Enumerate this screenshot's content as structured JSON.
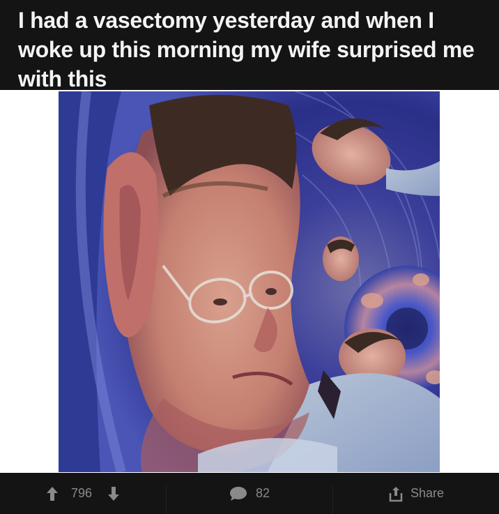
{
  "post": {
    "title": "I had a vasectomy yesterday and when I woke up this morning my wife surprised me with this"
  },
  "image": {
    "alt": "Swirled, distorted portrait of a balding man with glasses, repeated in a spiral pattern"
  },
  "actions": {
    "upvote_icon": "arrow-up-icon",
    "vote_count": "796",
    "downvote_icon": "arrow-down-icon",
    "comment_icon": "speech-bubble-icon",
    "comment_count": "82",
    "share_icon": "share-icon",
    "share_label": "Share"
  },
  "colors": {
    "bar_background": "#141414",
    "title_text": "#f4f4f4",
    "action_text": "#8a8a8a",
    "page_background": "#ffffff"
  }
}
